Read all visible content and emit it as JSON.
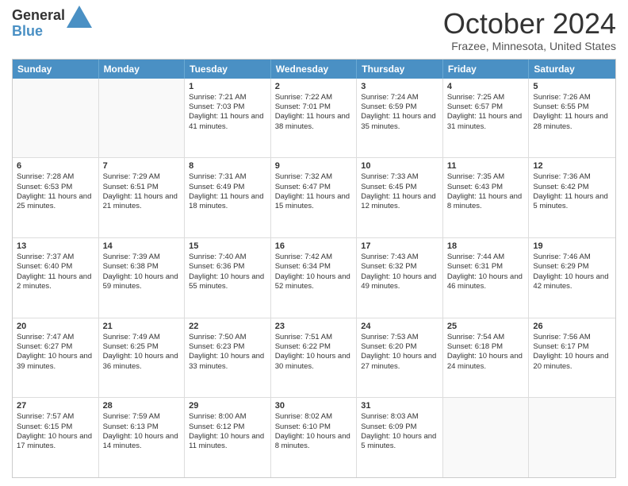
{
  "header": {
    "logo_line1": "General",
    "logo_line2": "Blue",
    "title": "October 2024",
    "subtitle": "Frazee, Minnesota, United States"
  },
  "weekdays": [
    "Sunday",
    "Monday",
    "Tuesday",
    "Wednesday",
    "Thursday",
    "Friday",
    "Saturday"
  ],
  "rows": [
    [
      {
        "day": "",
        "empty": true
      },
      {
        "day": "",
        "empty": true
      },
      {
        "day": "1",
        "sunrise": "Sunrise: 7:21 AM",
        "sunset": "Sunset: 7:03 PM",
        "daylight": "Daylight: 11 hours and 41 minutes."
      },
      {
        "day": "2",
        "sunrise": "Sunrise: 7:22 AM",
        "sunset": "Sunset: 7:01 PM",
        "daylight": "Daylight: 11 hours and 38 minutes."
      },
      {
        "day": "3",
        "sunrise": "Sunrise: 7:24 AM",
        "sunset": "Sunset: 6:59 PM",
        "daylight": "Daylight: 11 hours and 35 minutes."
      },
      {
        "day": "4",
        "sunrise": "Sunrise: 7:25 AM",
        "sunset": "Sunset: 6:57 PM",
        "daylight": "Daylight: 11 hours and 31 minutes."
      },
      {
        "day": "5",
        "sunrise": "Sunrise: 7:26 AM",
        "sunset": "Sunset: 6:55 PM",
        "daylight": "Daylight: 11 hours and 28 minutes."
      }
    ],
    [
      {
        "day": "6",
        "sunrise": "Sunrise: 7:28 AM",
        "sunset": "Sunset: 6:53 PM",
        "daylight": "Daylight: 11 hours and 25 minutes."
      },
      {
        "day": "7",
        "sunrise": "Sunrise: 7:29 AM",
        "sunset": "Sunset: 6:51 PM",
        "daylight": "Daylight: 11 hours and 21 minutes."
      },
      {
        "day": "8",
        "sunrise": "Sunrise: 7:31 AM",
        "sunset": "Sunset: 6:49 PM",
        "daylight": "Daylight: 11 hours and 18 minutes."
      },
      {
        "day": "9",
        "sunrise": "Sunrise: 7:32 AM",
        "sunset": "Sunset: 6:47 PM",
        "daylight": "Daylight: 11 hours and 15 minutes."
      },
      {
        "day": "10",
        "sunrise": "Sunrise: 7:33 AM",
        "sunset": "Sunset: 6:45 PM",
        "daylight": "Daylight: 11 hours and 12 minutes."
      },
      {
        "day": "11",
        "sunrise": "Sunrise: 7:35 AM",
        "sunset": "Sunset: 6:43 PM",
        "daylight": "Daylight: 11 hours and 8 minutes."
      },
      {
        "day": "12",
        "sunrise": "Sunrise: 7:36 AM",
        "sunset": "Sunset: 6:42 PM",
        "daylight": "Daylight: 11 hours and 5 minutes."
      }
    ],
    [
      {
        "day": "13",
        "sunrise": "Sunrise: 7:37 AM",
        "sunset": "Sunset: 6:40 PM",
        "daylight": "Daylight: 11 hours and 2 minutes."
      },
      {
        "day": "14",
        "sunrise": "Sunrise: 7:39 AM",
        "sunset": "Sunset: 6:38 PM",
        "daylight": "Daylight: 10 hours and 59 minutes."
      },
      {
        "day": "15",
        "sunrise": "Sunrise: 7:40 AM",
        "sunset": "Sunset: 6:36 PM",
        "daylight": "Daylight: 10 hours and 55 minutes."
      },
      {
        "day": "16",
        "sunrise": "Sunrise: 7:42 AM",
        "sunset": "Sunset: 6:34 PM",
        "daylight": "Daylight: 10 hours and 52 minutes."
      },
      {
        "day": "17",
        "sunrise": "Sunrise: 7:43 AM",
        "sunset": "Sunset: 6:32 PM",
        "daylight": "Daylight: 10 hours and 49 minutes."
      },
      {
        "day": "18",
        "sunrise": "Sunrise: 7:44 AM",
        "sunset": "Sunset: 6:31 PM",
        "daylight": "Daylight: 10 hours and 46 minutes."
      },
      {
        "day": "19",
        "sunrise": "Sunrise: 7:46 AM",
        "sunset": "Sunset: 6:29 PM",
        "daylight": "Daylight: 10 hours and 42 minutes."
      }
    ],
    [
      {
        "day": "20",
        "sunrise": "Sunrise: 7:47 AM",
        "sunset": "Sunset: 6:27 PM",
        "daylight": "Daylight: 10 hours and 39 minutes."
      },
      {
        "day": "21",
        "sunrise": "Sunrise: 7:49 AM",
        "sunset": "Sunset: 6:25 PM",
        "daylight": "Daylight: 10 hours and 36 minutes."
      },
      {
        "day": "22",
        "sunrise": "Sunrise: 7:50 AM",
        "sunset": "Sunset: 6:23 PM",
        "daylight": "Daylight: 10 hours and 33 minutes."
      },
      {
        "day": "23",
        "sunrise": "Sunrise: 7:51 AM",
        "sunset": "Sunset: 6:22 PM",
        "daylight": "Daylight: 10 hours and 30 minutes."
      },
      {
        "day": "24",
        "sunrise": "Sunrise: 7:53 AM",
        "sunset": "Sunset: 6:20 PM",
        "daylight": "Daylight: 10 hours and 27 minutes."
      },
      {
        "day": "25",
        "sunrise": "Sunrise: 7:54 AM",
        "sunset": "Sunset: 6:18 PM",
        "daylight": "Daylight: 10 hours and 24 minutes."
      },
      {
        "day": "26",
        "sunrise": "Sunrise: 7:56 AM",
        "sunset": "Sunset: 6:17 PM",
        "daylight": "Daylight: 10 hours and 20 minutes."
      }
    ],
    [
      {
        "day": "27",
        "sunrise": "Sunrise: 7:57 AM",
        "sunset": "Sunset: 6:15 PM",
        "daylight": "Daylight: 10 hours and 17 minutes."
      },
      {
        "day": "28",
        "sunrise": "Sunrise: 7:59 AM",
        "sunset": "Sunset: 6:13 PM",
        "daylight": "Daylight: 10 hours and 14 minutes."
      },
      {
        "day": "29",
        "sunrise": "Sunrise: 8:00 AM",
        "sunset": "Sunset: 6:12 PM",
        "daylight": "Daylight: 10 hours and 11 minutes."
      },
      {
        "day": "30",
        "sunrise": "Sunrise: 8:02 AM",
        "sunset": "Sunset: 6:10 PM",
        "daylight": "Daylight: 10 hours and 8 minutes."
      },
      {
        "day": "31",
        "sunrise": "Sunrise: 8:03 AM",
        "sunset": "Sunset: 6:09 PM",
        "daylight": "Daylight: 10 hours and 5 minutes."
      },
      {
        "day": "",
        "empty": true
      },
      {
        "day": "",
        "empty": true
      }
    ]
  ]
}
